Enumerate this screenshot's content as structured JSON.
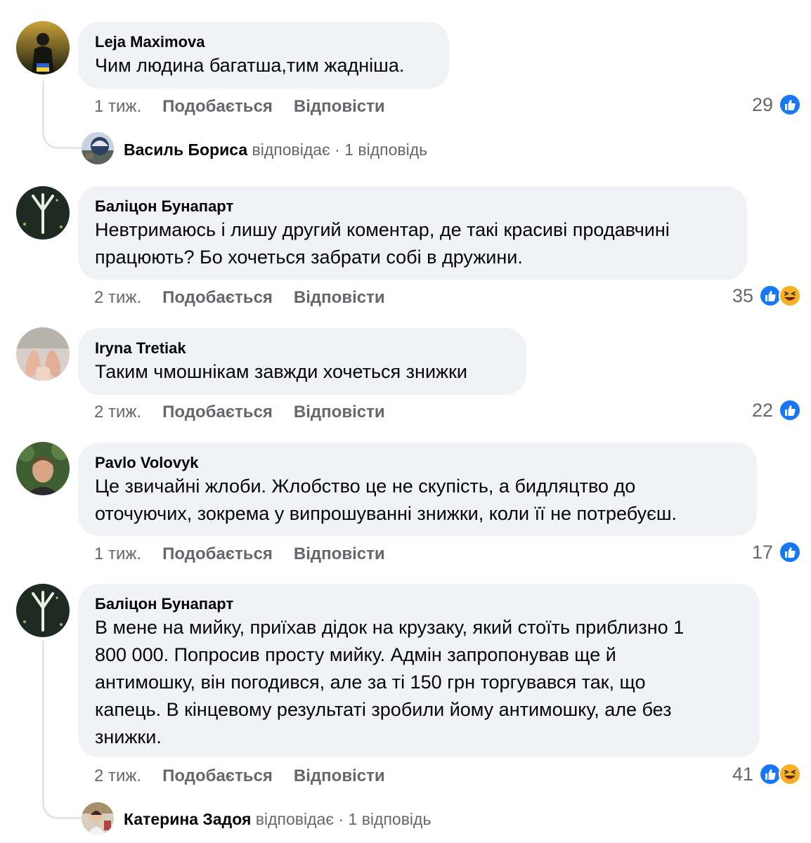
{
  "colors": {
    "bubble": "#f0f2f5",
    "secondary_text": "#65676b",
    "like_blue": "#1877f2",
    "haha_yellow": "#f7b125"
  },
  "comments": [
    {
      "author": "Leja Maximova",
      "text": "Чим людина багатша,тим жаднiша.",
      "time": "1 тиж.",
      "like_label": "Подобається",
      "reply_label": "Відповісти",
      "reactions_count": "29",
      "reaction_icons": [
        "like-icon"
      ],
      "reply": {
        "author": "Василь Бориса",
        "verb": "відповідає",
        "separator": "·",
        "count": "1 відповідь"
      }
    },
    {
      "author": "Баліцон Бунапарт",
      "text": "Невтримаюсь і лишу другий коментар, де такі красиві продавчині\nпрацюють? Бо хочеться забрати собі в дружини.",
      "time": "2 тиж.",
      "like_label": "Подобається",
      "reply_label": "Відповісти",
      "reactions_count": "35",
      "reaction_icons": [
        "like-icon",
        "haha-icon"
      ]
    },
    {
      "author": "Iryna Tretiak",
      "text": "Таким чмошнікам завжди хочеться знижки",
      "time": "2 тиж.",
      "like_label": "Подобається",
      "reply_label": "Відповісти",
      "reactions_count": "22",
      "reaction_icons": [
        "like-icon"
      ]
    },
    {
      "author": "Pavlo Volovyk",
      "text": "Це звичайні жлоби. Жлобство це не скупість, а бидляцтво до\nоточуючих, зокрема у випрошуванні знижки, коли її не потребуєш.",
      "time": "1 тиж.",
      "like_label": "Подобається",
      "reply_label": "Відповісти",
      "reactions_count": "17",
      "reaction_icons": [
        "like-icon"
      ]
    },
    {
      "author": "Баліцон Бунапарт",
      "text": "В мене на мийку, приїхав дідок на крузаку, який стоїть приблизно 1\n800 000. Попросив просту мийку. Адмін запропонував ще й\nантимошку, він погодився, але за ті 150 грн торгувався так, що\nкапець. В кінцевому результаті зробили йому антимошку, але без\nзнижки.",
      "time": "2 тиж.",
      "like_label": "Подобається",
      "reply_label": "Відповісти",
      "reactions_count": "41",
      "reaction_icons": [
        "like-icon",
        "haha-icon"
      ],
      "reply": {
        "author": "Катерина Задоя",
        "verb": "відповідає",
        "separator": "·",
        "count": "1 відповідь"
      }
    }
  ]
}
